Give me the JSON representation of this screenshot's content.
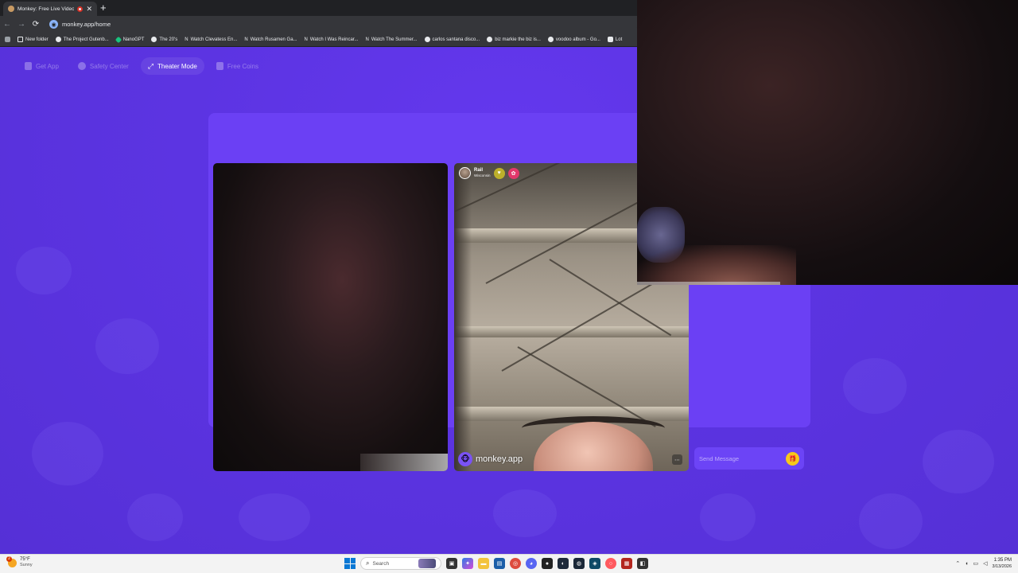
{
  "browser": {
    "tab": {
      "title": "Monkey: Free Live Video Ch",
      "close_glyph": "✕"
    },
    "new_tab_glyph": "+",
    "nav": {
      "back": "←",
      "forward": "→",
      "reload": "⟳"
    },
    "address": {
      "url": "monkey.app/home"
    },
    "bookmarks": [
      {
        "label": "New folder",
        "icon": "folder-icon"
      },
      {
        "label": "The Project Gutenb...",
        "icon": "globe-icon"
      },
      {
        "label": "NanoGPT",
        "icon": "nanogpt-icon"
      },
      {
        "label": "The 20's",
        "icon": "globe-icon"
      },
      {
        "label": "Watch Clevatess En...",
        "icon": "n-icon"
      },
      {
        "label": "Watch Rusamen Ga...",
        "icon": "n-icon"
      },
      {
        "label": "Watch I Was Reincar...",
        "icon": "n-icon"
      },
      {
        "label": "Watch The Summer...",
        "icon": "n-icon"
      },
      {
        "label": "carlos santana disco...",
        "icon": "google-icon"
      },
      {
        "label": "biz markie the biz is...",
        "icon": "google-icon"
      },
      {
        "label": "voodoo album - Go...",
        "icon": "google-icon"
      },
      {
        "label": "Lot",
        "icon": "apps-icon"
      }
    ]
  },
  "page": {
    "nav": {
      "get_app": "Get App",
      "safety_center": "Safety Center",
      "theater_mode": "Theater Mode",
      "free_coins": "Free Coins"
    },
    "peer": {
      "name": "Rail",
      "location": "Wisconsin"
    },
    "watermark": "monkey.app",
    "chat": {
      "placeholder": "Send Message"
    }
  },
  "taskbar": {
    "weather": {
      "temp": "75°F",
      "condition": "Sunny",
      "badge": "2"
    },
    "search_label": "Search",
    "time": "1:35 PM",
    "date": "3/13/2026"
  },
  "colors": {
    "page_bg": "#5b36e0",
    "card_bg": "#6b40f4",
    "gift_yellow": "#f7c81a",
    "heart_badge": "#bdb02b",
    "gift_badge": "#e2386b"
  }
}
